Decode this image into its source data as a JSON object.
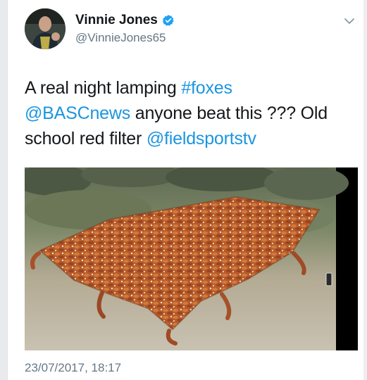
{
  "tweet": {
    "author_name": "Vinnie Jones",
    "author_handle": "@VinnieJones65",
    "text_parts": {
      "t1": "A real night lamping ",
      "hashtag": "#foxes",
      "mention1": "@BASCnews",
      "t2": " anyone beat this ??? Old school red filter ",
      "mention2": "@fieldsportstv"
    },
    "timestamp": "23/07/2017, 18:17"
  },
  "icons": {
    "verified": "verified-badge-icon",
    "menu": "chevron-down-icon"
  },
  "colors": {
    "link": "#1b95e0",
    "text": "#14171a",
    "muted": "#657786",
    "verified": "#1da1f2"
  }
}
